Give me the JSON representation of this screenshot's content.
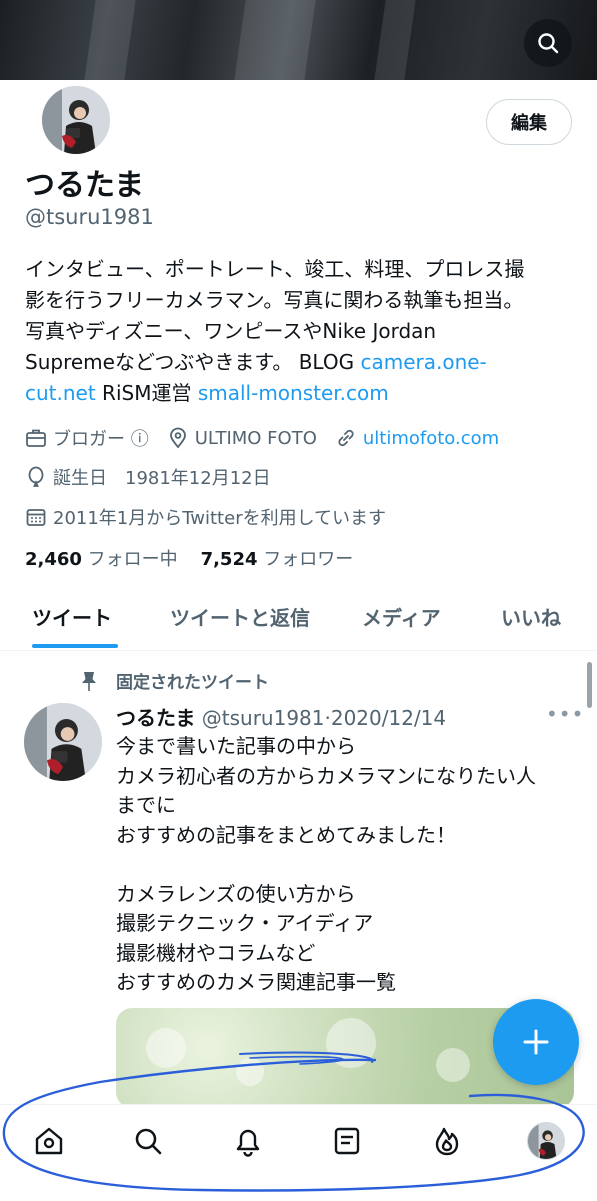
{
  "header": {
    "search_icon": "search-icon"
  },
  "profile": {
    "edit_label": "編集",
    "display_name": "つるたま",
    "handle": "@tsuru1981",
    "bio": {
      "line1": "インタビュー、ポートレート、竣工、料理、プロレス撮",
      "line2": "影を行うフリーカメラマン。写真に関わる執筆も担当。",
      "line3": "写真やディズニー、ワンピースやNike Jordan",
      "line4_text": "Supremeなどつぶやきます。 BLOG ",
      "line4_link": "camera.one-",
      "line5_link1": "cut.net",
      "line5_text": " RiSM運営 ",
      "line5_link2": "small-monster.com"
    },
    "category": "ブロガー ⓘ",
    "location": "ULTIMO FOTO",
    "website": "ultimofoto.com",
    "birthday": "誕生日　1981年12月12日",
    "joined": "2011年1月からTwitterを利用しています",
    "following_count": "2,460",
    "following_label": "フォロー中",
    "followers_count": "7,524",
    "followers_label": "フォロワー"
  },
  "tabs": [
    "ツイート",
    "ツイートと返信",
    "メディア",
    "いいね"
  ],
  "pinned_tweet": {
    "pinned_label": "固定されたツイート",
    "author_name": "つるたま",
    "author_handle": "@tsuru1981",
    "date": "·2020/12/14",
    "more": "•••",
    "lines": [
      "今まで書いた記事の中から",
      "カメラ初心者の方からカメラマンになりたい人",
      "までに",
      "おすすめの記事をまとめてみました！",
      "",
      "カメラレンズの使い方から",
      "撮影テクニック・アイディア",
      "撮影機材やコラムなど",
      "おすすめのカメラ関連記事一覧"
    ]
  },
  "fab": {
    "icon": "plus-icon"
  },
  "bottom_nav": [
    "home-icon",
    "search-icon",
    "bell-icon",
    "article-icon",
    "flame-icon",
    "avatar"
  ],
  "colors": {
    "accent": "#1d9bf0",
    "text": "#0f1419",
    "muted": "#536471",
    "annotation": "#2b5fd9"
  }
}
